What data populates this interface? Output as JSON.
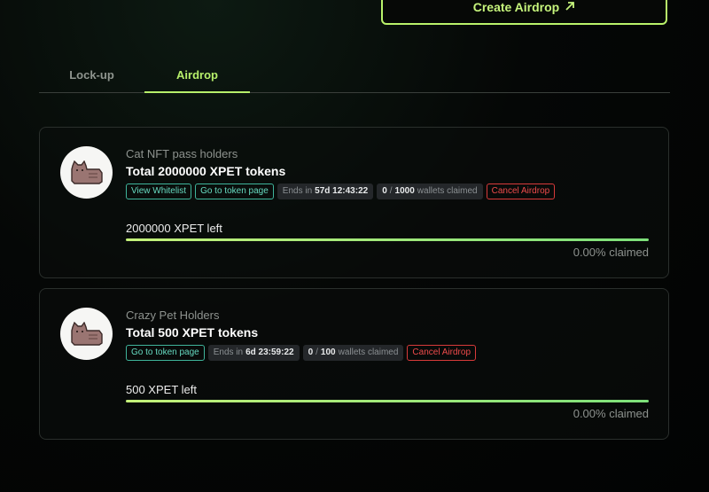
{
  "header": {
    "create_label": "Create Airdrop",
    "create_icon": "arrow-up-right-icon"
  },
  "tabs": [
    {
      "label": "Lock-up",
      "active": false
    },
    {
      "label": "Airdrop",
      "active": true
    }
  ],
  "airdrops": [
    {
      "name": "Cat NFT pass holders",
      "total": "Total 2000000 XPET tokens",
      "view_whitelist": "View Whitelist",
      "token_page": "Go to token page",
      "ends_prefix": "Ends in",
      "ends_value": "57d 12:43:22",
      "wallets_claimed": "0",
      "wallets_sep": "/",
      "wallets_total": "1000",
      "wallets_suffix": "wallets claimed",
      "cancel": "Cancel Airdrop",
      "left": "2000000 XPET left",
      "claimed": "0.00% claimed",
      "claimed_fraction": 0.0
    },
    {
      "name": "Crazy Pet Holders",
      "total": "Total 500 XPET tokens",
      "token_page": "Go to token page",
      "ends_prefix": "Ends in",
      "ends_value": "6d 23:59:22",
      "wallets_claimed": "0",
      "wallets_sep": "/",
      "wallets_total": "100",
      "wallets_suffix": "wallets claimed",
      "cancel": "Cancel Airdrop",
      "left": "500 XPET left",
      "claimed": "0.00% claimed",
      "claimed_fraction": 0.0
    }
  ],
  "colors": {
    "accent": "#b6ef6a",
    "teal": "#66d9c0",
    "danger": "#ef4b4b"
  }
}
